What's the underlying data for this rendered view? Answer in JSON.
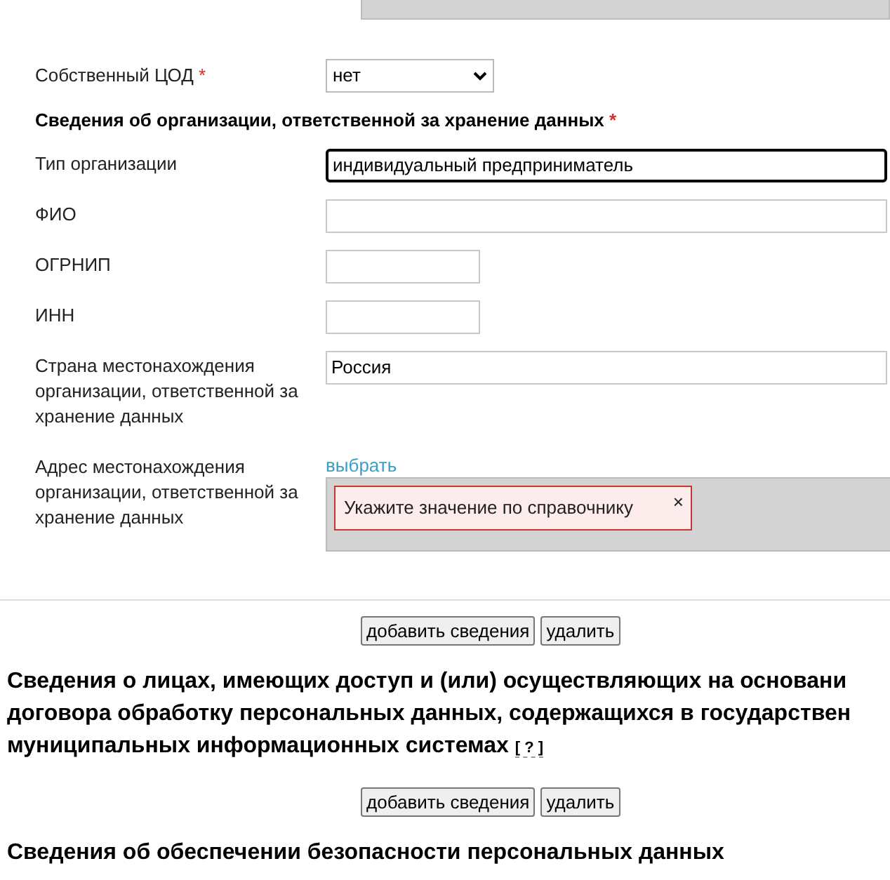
{
  "own_datacenter": {
    "label": "Собственный ЦОД",
    "required_mark": "*",
    "value": "нет"
  },
  "org_section": {
    "title": "Сведения об организации, ответственной за хранение данных",
    "required_mark": "*"
  },
  "fields": [
    {
      "kind": "wide",
      "label": "Тип организации",
      "value": "индивидуальный предприниматель",
      "focused": true
    },
    {
      "kind": "wide",
      "label": "ФИО",
      "focused": false
    },
    {
      "kind": "short",
      "label": "ОГРНИП",
      "focused": false
    },
    {
      "kind": "short",
      "label": "ИНН",
      "focused": false
    },
    {
      "kind": "wide",
      "label": "Страна местонахождения организации, ответственной за хранение данных",
      "value": "Россия",
      "focused": false
    }
  ],
  "address": {
    "label": "Адрес местонахождения организации, ответственной за хранение данных",
    "link": "выбрать",
    "error": "Укажите значение по справочнику",
    "close": "×"
  },
  "buttons_1": [
    "добавить сведения",
    "удалить"
  ],
  "access_section": {
    "lines": [
      "Сведения о лицах, имеющих доступ и (или) осуществляющих на основани",
      "договора обработку персональных данных, содержащихся в государствен",
      "муниципальных информационных системах"
    ],
    "help": "[ ? ]"
  },
  "buttons_2": [
    "добавить сведения",
    "удалить"
  ],
  "security_section": {
    "title": "Сведения об обеспечении безопасности персональных данных"
  }
}
